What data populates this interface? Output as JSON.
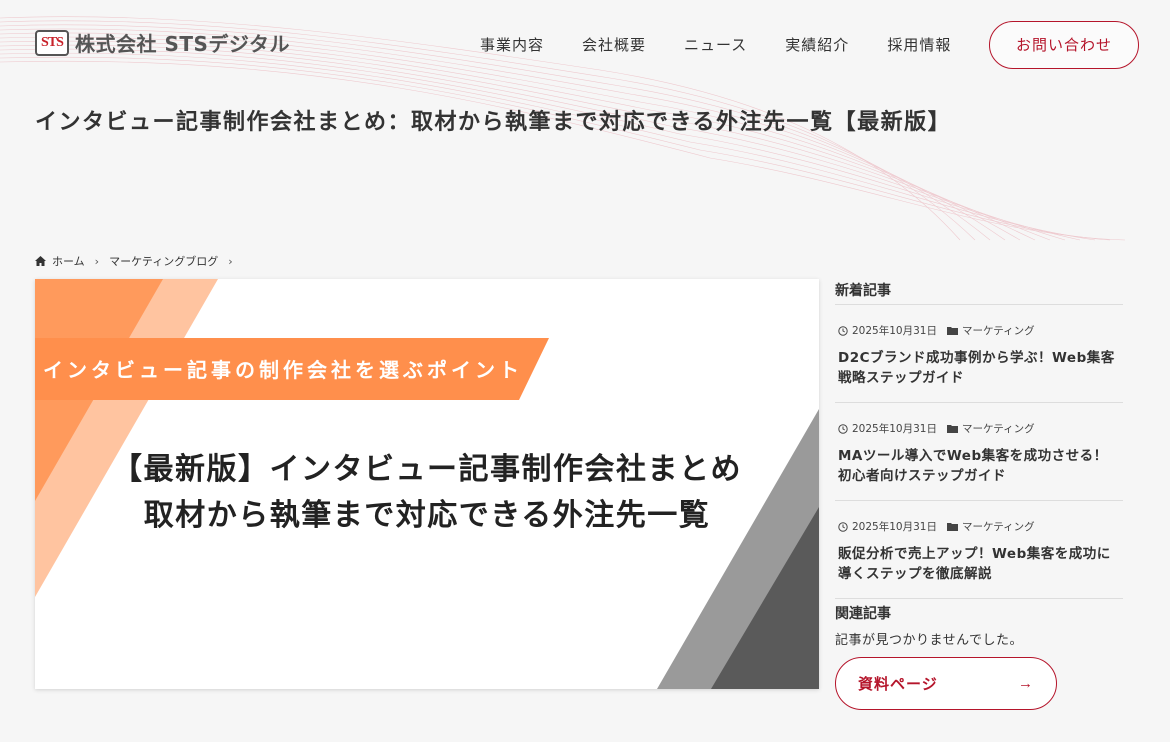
{
  "brand": {
    "logo_mark": "STS",
    "name": "株式会社 STSデジタル"
  },
  "nav": {
    "items": [
      {
        "label": "事業内容"
      },
      {
        "label": "会社概要"
      },
      {
        "label": "ニュース"
      },
      {
        "label": "実績紹介"
      },
      {
        "label": "採用情報"
      }
    ],
    "contact_label": "お問い合わせ"
  },
  "page": {
    "title": "インタビュー記事制作会社まとめ：取材から執筆まで対応できる外注先一覧【最新版】"
  },
  "breadcrumb": {
    "home": "ホーム",
    "category": "マーケティングブログ"
  },
  "hero": {
    "banner": "インタビュー記事の制作会社を選ぶポイント",
    "line1": "【最新版】インタビュー記事制作会社まとめ",
    "line2": "取材から執筆まで対応できる外注先一覧"
  },
  "sidebar": {
    "latest_heading": "新着記事",
    "articles": [
      {
        "date": "2025年10月31日",
        "category": "マーケティング",
        "title": "D2Cブランド成功事例から学ぶ！Web集客戦略ステップガイド"
      },
      {
        "date": "2025年10月31日",
        "category": "マーケティング",
        "title": "MAツール導入でWeb集客を成功させる！初心者向けステップガイド"
      },
      {
        "date": "2025年10月31日",
        "category": "マーケティング",
        "title": "販促分析で売上アップ！Web集客を成功に導くステップを徹底解説"
      }
    ],
    "related_heading": "関連記事",
    "related_empty": "記事が見つかりませんでした。",
    "docs_button": "資料ページ"
  },
  "colors": {
    "accent": "#b5152b",
    "orange": "#ff9a5c",
    "light_orange": "#ffc4a0",
    "gray": "#9a9a9a",
    "dark_gray": "#5a5a5a"
  }
}
